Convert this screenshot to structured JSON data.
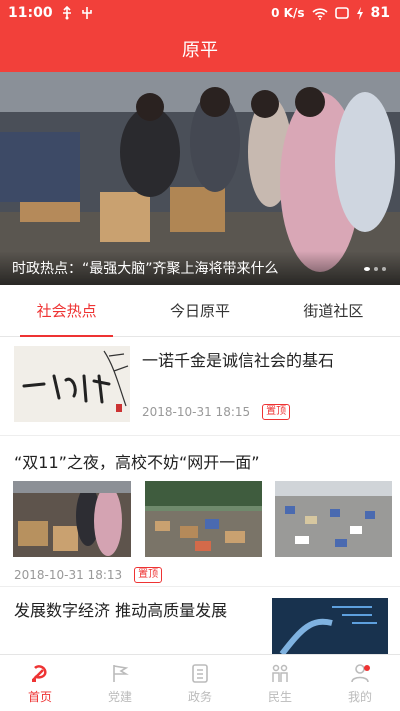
{
  "status": {
    "time": "11:00",
    "network_speed": "0 K/s",
    "battery": "81"
  },
  "header": {
    "title": "原平"
  },
  "banner": {
    "caption": "时政热点：“最强大脑”齐聚上海将带来什么",
    "image": "crowd-at-market-photo"
  },
  "tabs": [
    {
      "label": "社会热点",
      "active": true
    },
    {
      "label": "今日原平",
      "active": false
    },
    {
      "label": "街道社区",
      "active": false
    }
  ],
  "articles": [
    {
      "title": "一诺千金是诚信社会的基石",
      "date": "2018-10-31 18:15",
      "badge": "置顶",
      "image": "calligraphy-yinuoqianjin"
    },
    {
      "title": "“双11”之夜，高校不妨“网开一面”",
      "date": "2018-10-31 18:13",
      "badge": "置顶",
      "images": [
        "students-parcels-photo",
        "parcels-on-ground-photo",
        "campus-parcels-photo"
      ]
    },
    {
      "title": "发展数字经济 推动高质量发展",
      "image": "digital-hand-photo"
    }
  ],
  "bottom_nav": [
    {
      "label": "首页",
      "icon": "party-emblem-icon",
      "active": true
    },
    {
      "label": "党建",
      "icon": "flag-icon",
      "active": false
    },
    {
      "label": "政务",
      "icon": "building-icon",
      "active": false
    },
    {
      "label": "民生",
      "icon": "people-icon",
      "active": false
    },
    {
      "label": "我的",
      "icon": "user-icon",
      "active": false
    }
  ],
  "colors": {
    "brand": "#f2403a",
    "accent": "#e33",
    "muted": "#999999"
  }
}
